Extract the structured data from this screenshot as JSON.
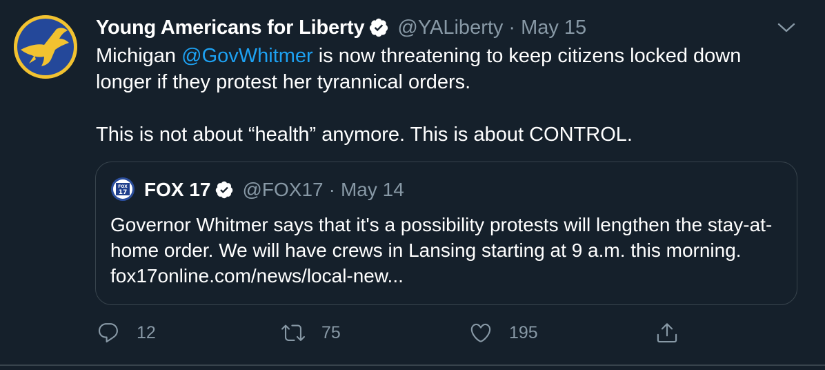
{
  "tweet": {
    "display_name": "Young Americans for Liberty",
    "handle": "@YALiberty",
    "separator": "·",
    "date": "May 15",
    "avatar_icon": "eagle-logo",
    "verified_icon": "verified-badge-icon",
    "more_icon": "chevron-down-icon",
    "text": {
      "line1_before": "Michigan ",
      "mention": "@GovWhitmer",
      "line1_after": " is now threatening to keep citizens locked down longer if they protest her tyrannical orders.",
      "paragraph2": "This is not about “health” anymore. This is about CONTROL."
    }
  },
  "quote": {
    "display_name": "FOX 17",
    "handle": "@FOX17",
    "separator": "·",
    "date": "May 14",
    "avatar_text": "FOX 17",
    "text": "Governor Whitmer says that it's a possibility protests will lengthen the stay-at-home order. We will have crews in Lansing starting at 9 a.m. this morning. fox17online.com/news/local-new..."
  },
  "actions": {
    "reply_count": "12",
    "retweet_count": "75",
    "like_count": "195",
    "icons": [
      "reply-icon",
      "retweet-icon",
      "like-icon",
      "share-icon"
    ]
  },
  "colors": {
    "background": "#15202b",
    "secondary_text": "#8899a6",
    "link": "#1da1f2",
    "border": "#38444d",
    "avatar_gold": "#f2c230",
    "avatar_blue": "#24489a"
  }
}
